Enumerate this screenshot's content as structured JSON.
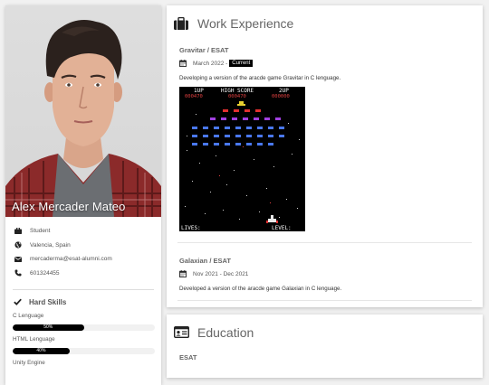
{
  "profile": {
    "name": "Alex Mercader Mateo",
    "role": "Student",
    "location": "Valencia, Spain",
    "email": "mercaderma@esat-alumni.com",
    "phone": "601324455"
  },
  "skills": {
    "title": "Hard Skills",
    "items": [
      {
        "label": "C Lenguage",
        "percent_text": "50%",
        "value": 0.5
      },
      {
        "label": "HTML Lenguage",
        "percent_text": "40%",
        "value": 0.4
      },
      {
        "label": "Unity Engine",
        "percent_text": "",
        "value": 0
      }
    ]
  },
  "work": {
    "title": "Work Experience",
    "jobs": [
      {
        "title": "Gravitar / ESAT",
        "date": "March 2022 -",
        "badge": "Current",
        "description": "Developing a version of the aracde game Gravitar in C lenguage."
      },
      {
        "title": "Galaxian / ESAT",
        "date": "Nov 2021 - Dec 2021",
        "description": "Developed a version of the aracde game Galaxian in C lenguage."
      }
    ],
    "game_screen": {
      "player_label": "1UP",
      "hiscore_label": "HIGH SCORE",
      "player2_label": "2UP",
      "score1": "000470",
      "hiscore": "000470",
      "score2": "000000",
      "lives_label": "LIVES:",
      "level_label": "LEVEL:"
    }
  },
  "education": {
    "title": "Education",
    "entries": [
      {
        "title": "ESAT"
      }
    ]
  },
  "colors": {
    "accent": "#000000",
    "page_bg": "#f1f1f1",
    "card_bg": "#ffffff"
  }
}
